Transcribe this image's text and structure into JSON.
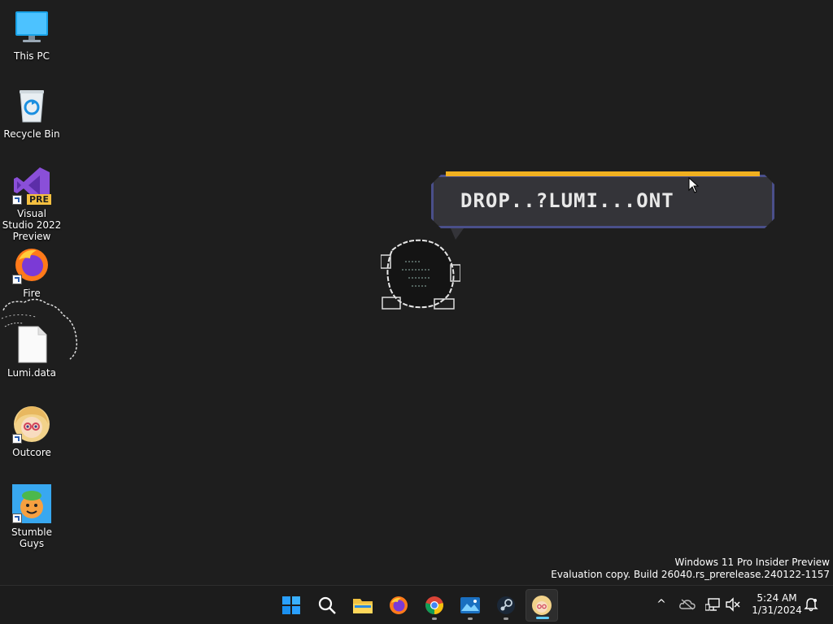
{
  "desktop": {
    "icons": [
      {
        "label": "This PC",
        "icon": "this-pc-icon"
      },
      {
        "label": "Recycle Bin",
        "icon": "recycle-bin-icon"
      },
      {
        "label": "Visual Studio 2022 Preview",
        "badge": "PRE",
        "icon": "visual-studio-icon"
      },
      {
        "label": "Fire",
        "icon": "firefox-icon"
      },
      {
        "label": "Lumi.data",
        "icon": "file-icon"
      },
      {
        "label": "Outcore",
        "icon": "outcore-icon"
      },
      {
        "label": "Stumble Guys",
        "icon": "stumble-guys-icon"
      }
    ]
  },
  "bubble": {
    "text": "DROP..?LUMI...ONT"
  },
  "watermark": {
    "line1": "Windows 11 Pro Insider Preview",
    "line2": "Evaluation copy. Build 26040.rs_prerelease.240122-1157"
  },
  "taskbar": {
    "apps": [
      "start-icon",
      "search-icon",
      "file-explorer-icon",
      "firefox-icon",
      "chrome-icon",
      "photos-icon",
      "steam-icon",
      "outcore-icon"
    ],
    "tray": {
      "chevron": "^",
      "time": "5:24 AM",
      "date": "1/31/2024"
    }
  },
  "colors": {
    "desktop_bg": "#1e1e1e",
    "bubble_bar": "#f0b020",
    "bubble_border": "#4a4f8a",
    "accent": "#60cdff"
  }
}
